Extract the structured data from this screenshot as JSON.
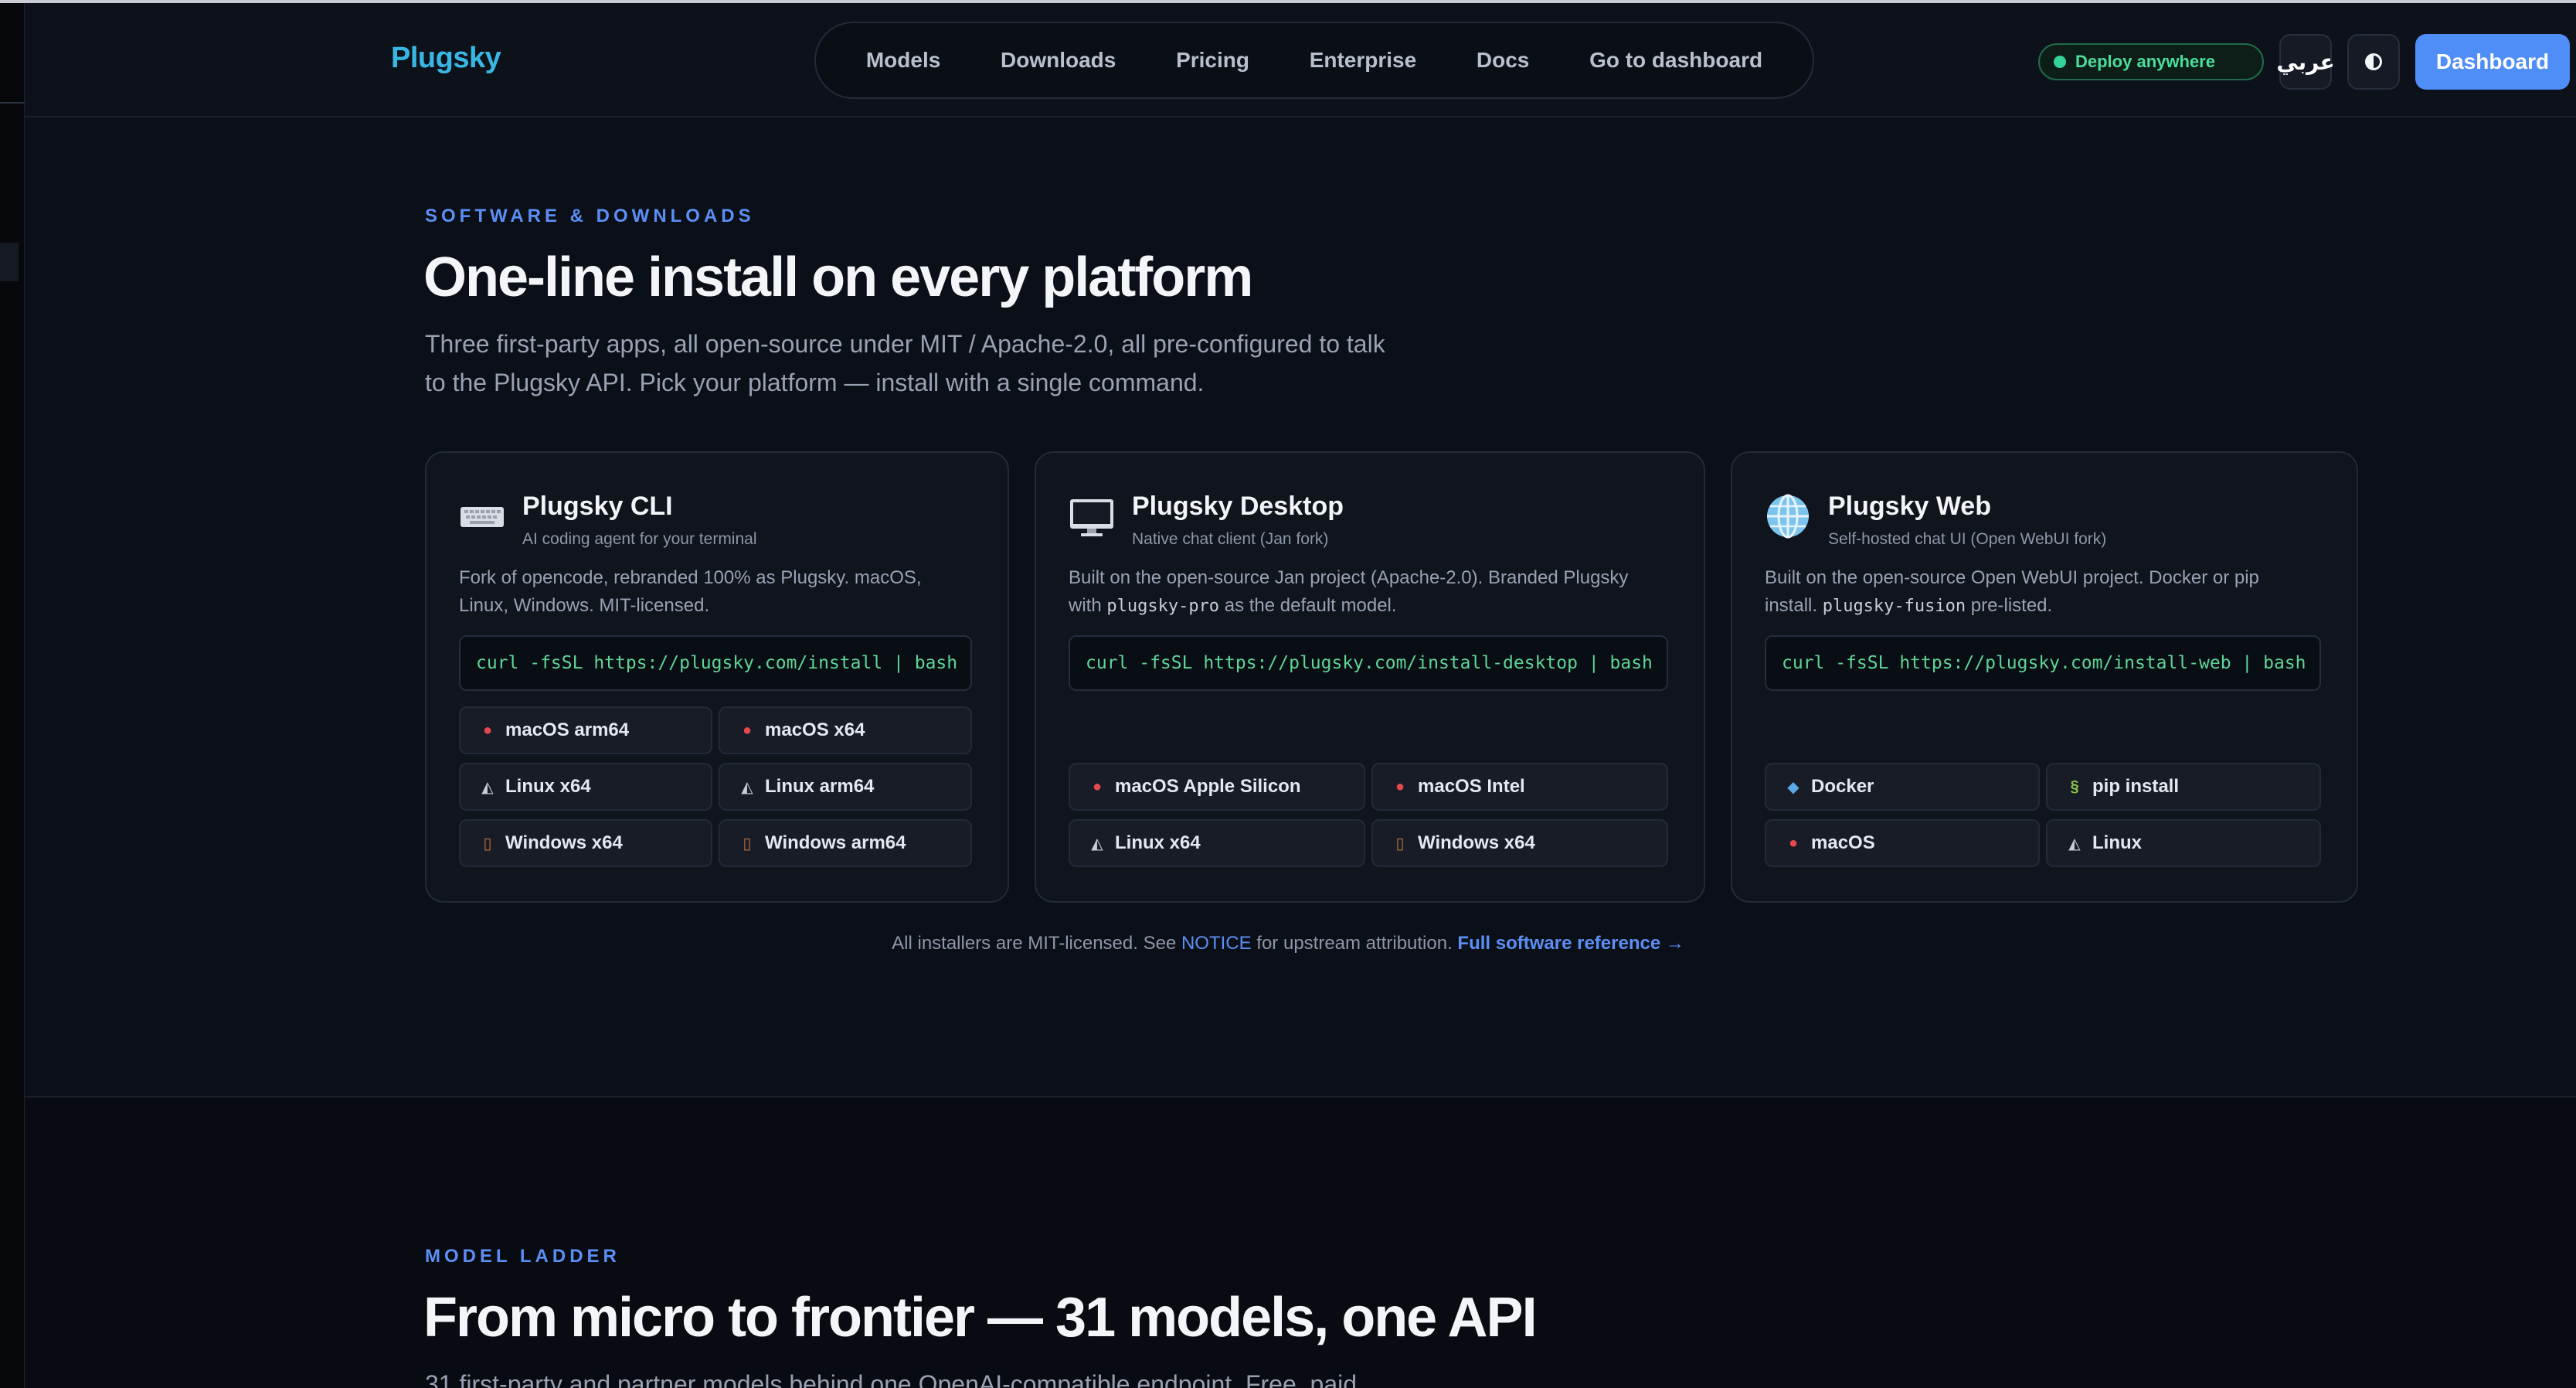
{
  "header": {
    "brand": "Plugsky",
    "nav": [
      "Models",
      "Downloads",
      "Pricing",
      "Enterprise",
      "Docs",
      "Go to dashboard"
    ],
    "deploy_badge": "Deploy anywhere",
    "lang_label": "عربي",
    "theme_icon": "contrast-icon",
    "dashboard_label": "Dashboard"
  },
  "software": {
    "eyebrow": "SOFTWARE & DOWNLOADS",
    "title": "One-line install on every platform",
    "lead_line1": "Three first-party apps, all open-source under MIT / Apache-2.0, all pre-configured to talk",
    "lead_line2": "to the Plugsky API. Pick your platform — install with a single command."
  },
  "cards": [
    {
      "title": "Plugsky CLI",
      "subtitle": "AI coding agent for your terminal",
      "icon": "keyboard-icon",
      "desc_line1": "Fork of opencode, rebranded 100% as Plugsky. macOS,",
      "desc_line2": "Linux, Windows. MIT-licensed.",
      "command": "curl -fsSL https://plugsky.com/install | bash",
      "platforms": [
        {
          "label": "macOS arm64",
          "icon": "apple-icon"
        },
        {
          "label": "macOS x64",
          "icon": "apple-icon"
        },
        {
          "label": "Linux x64",
          "icon": "penguin-icon"
        },
        {
          "label": "Linux arm64",
          "icon": "penguin-icon"
        },
        {
          "label": "Windows x64",
          "icon": "window-icon"
        },
        {
          "label": "Windows arm64",
          "icon": "window-icon"
        }
      ]
    },
    {
      "title": "Plugsky Desktop",
      "subtitle": "Native chat client (Jan fork)",
      "icon": "desktop-icon",
      "desc_line1": "Built on the open-source Jan project (Apache-2.0). Branded Plugsky",
      "desc_pre": "with ",
      "desc_code": "plugsky-pro",
      "desc_post": " as the default model.",
      "command": "curl -fsSL https://plugsky.com/install-desktop | bash",
      "platforms": [
        {
          "label": "macOS Apple Silicon",
          "icon": "apple-icon"
        },
        {
          "label": "macOS Intel",
          "icon": "apple-icon"
        },
        {
          "label": "Linux x64",
          "icon": "penguin-icon"
        },
        {
          "label": "Windows x64",
          "icon": "window-icon"
        }
      ]
    },
    {
      "title": "Plugsky Web",
      "subtitle": "Self-hosted chat UI (Open WebUI fork)",
      "icon": "globe-icon",
      "desc_line1": "Built on the open-source Open WebUI project. Docker or pip",
      "desc_pre": "install. ",
      "desc_code": "plugsky-fusion",
      "desc_post": " pre-listed.",
      "command": "curl -fsSL https://plugsky.com/install-web | bash",
      "platforms": [
        {
          "label": "Docker",
          "icon": "whale-icon"
        },
        {
          "label": "pip install",
          "icon": "snake-icon"
        },
        {
          "label": "macOS",
          "icon": "apple-icon"
        },
        {
          "label": "Linux",
          "icon": "penguin-icon"
        }
      ]
    }
  ],
  "footnote": {
    "pre": "All installers are MIT-licensed. See ",
    "link": "NOTICE",
    "mid": " for upstream attribution. ",
    "ref": "Full software reference →"
  },
  "ladder": {
    "eyebrow": "MODEL LADDER",
    "title": "From micro to frontier — 31 models, one API",
    "lead_partial": "31 first-party and partner models behind one OpenAI-compatible endpoint. Free, paid,"
  }
}
